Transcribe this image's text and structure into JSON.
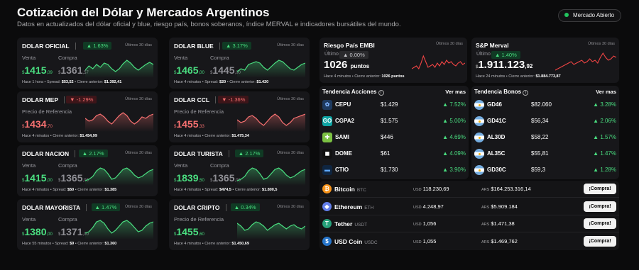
{
  "header": {
    "title": "Cotización del Dólar y Mercados Argentinos",
    "subtitle": "Datos en actualizados del dólar oficial y blue, riesgo país, bonos soberanos, índice MERVAL e indicadores bursátiles del mundo.",
    "status": "Mercado Abierto"
  },
  "colors": {
    "up": "#4ade80",
    "down": "#f87171",
    "muted": "#8f8f95",
    "panel": "#17171a",
    "background": "#0b0b0c"
  },
  "dollars": [
    {
      "name": "DOLAR OFICIAL",
      "change": "▲ 1.63%",
      "dir": "up",
      "period": "Últimos 30 días",
      "label1": "Venta",
      "label2": "Compra",
      "sell_main": "1415",
      "sell_dec": ",09",
      "buy_main": "1361",
      "buy_dec": ",57",
      "currency": "$",
      "footer": {
        "time": "Hace 1 hora",
        "metric_label": "Spread",
        "metric_value": "$53,52",
        "close_label": "Cierre anterior",
        "close_value": "$1.392,41"
      }
    },
    {
      "name": "DOLAR BLUE",
      "change": "▲ 3.17%",
      "dir": "up",
      "period": "Últimos 30 días",
      "label1": "Venta",
      "label2": "Compra",
      "sell_main": "1465",
      "sell_dec": ",00",
      "buy_main": "1445",
      "buy_dec": ",00",
      "currency": "$",
      "footer": {
        "time": "Hace 4 minutos",
        "metric_label": "Spread",
        "metric_value": "$20",
        "close_label": "Cierre anterior",
        "close_value": "$1.420"
      }
    },
    {
      "name": "DOLAR MEP",
      "change": "▼ -1.29%",
      "dir": "down",
      "period": "Últimos 30 días",
      "label1": "Precio de Referencia",
      "label2": "",
      "sell_main": "1434",
      "sell_dec": ",70",
      "buy_main": "",
      "buy_dec": "",
      "currency": "$",
      "footer": {
        "time": "Hace 4 minutos",
        "metric_label": "",
        "metric_value": "",
        "close_label": "Cierre anterior",
        "close_value": "$1.454,99"
      }
    },
    {
      "name": "DOLAR CCL",
      "change": "▼ -1.36%",
      "dir": "down",
      "period": "Últimos 30 días",
      "label1": "Precio de Referencia",
      "label2": "",
      "sell_main": "1455",
      "sell_dec": ",33",
      "buy_main": "",
      "buy_dec": "",
      "currency": "$",
      "footer": {
        "time": "Hace 4 minutos",
        "metric_label": "",
        "metric_value": "",
        "close_label": "Cierre anterior",
        "close_value": "$1.475,34"
      }
    },
    {
      "name": "DOLAR NACION",
      "change": "▲ 2.17%",
      "dir": "up",
      "period": "Últimos 30 días",
      "label1": "Venta",
      "label2": "Compra",
      "sell_main": "1415",
      "sell_dec": ",00",
      "buy_main": "1365",
      "buy_dec": ",00",
      "currency": "$",
      "footer": {
        "time": "Hace 4 minutos",
        "metric_label": "Spread",
        "metric_value": "$50",
        "close_label": "Cierre anterior",
        "close_value": "$1.385"
      }
    },
    {
      "name": "DOLAR TURISTA",
      "change": "▲ 2.17%",
      "dir": "up",
      "period": "Últimos 30 días",
      "label1": "Venta",
      "label2": "Compra",
      "sell_main": "1839",
      "sell_dec": ",50",
      "buy_main": "1365",
      "buy_dec": ",00",
      "currency": "$",
      "footer": {
        "time": "Hace 4 minutos",
        "metric_label": "Spread",
        "metric_value": "$474,5",
        "close_label": "Cierre anterior",
        "close_value": "$1.800,5"
      }
    },
    {
      "name": "DOLAR MAYORISTA",
      "change": "▲ 1.47%",
      "dir": "up",
      "period": "Últimos 30 días",
      "label1": "Venta",
      "label2": "Compra",
      "sell_main": "1380",
      "sell_dec": ",00",
      "buy_main": "1371",
      "buy_dec": ",00",
      "currency": "$",
      "footer": {
        "time": "Hace 55 minutos",
        "metric_label": "Spread",
        "metric_value": "$9",
        "close_label": "Cierre anterior",
        "close_value": "$1.360"
      }
    },
    {
      "name": "DOLAR CRIPTO",
      "change": "▲ 0.34%",
      "dir": "up",
      "period": "Últimos 30 días",
      "label1": "Precio de Referencia",
      "label2": "",
      "sell_main": "1455",
      "sell_dec": ",60",
      "buy_main": "",
      "buy_dec": "",
      "currency": "$",
      "footer": {
        "time": "Hace 4 minutos",
        "metric_label": "",
        "metric_value": "",
        "close_label": "Cierre anterior",
        "close_value": "$1.450,69"
      }
    }
  ],
  "riesgo": {
    "title": "Riesgo País EMBI",
    "period": "Últimos 30 días",
    "label": "Último",
    "change": "▲ 0.00%",
    "value": "1026",
    "unit": "puntos",
    "footer_time": "Hace 4 minutos",
    "close_label": "Cierre anterior",
    "close_value": "1026 puntos"
  },
  "merval": {
    "title": "S&P Merval",
    "period": "Últimos 30 días",
    "label": "Último",
    "change": "▲ 1.40%",
    "value": "1.911.123",
    "value_dec": ",92",
    "currency": "$",
    "footer_time": "Hace 24 minutos",
    "close_label": "Cierre anterior",
    "close_value": "$1.884.773,87"
  },
  "acciones": {
    "title": "Tendencia Acciones",
    "more": "Ver mas",
    "rows": [
      {
        "name": "CEPU",
        "price": "$1.429",
        "change": "▲ 7.52%",
        "icon": "cepu-logo-icon",
        "glyph": "✿",
        "bg": "#1e3a5f",
        "fg": "#7fb3ff"
      },
      {
        "name": "CGPA2",
        "price": "$1.575",
        "change": "▲ 5.00%",
        "icon": "cgpa2-logo-icon",
        "glyph": "GO",
        "bg": "#0ea5a4",
        "fg": "#ffffff"
      },
      {
        "name": "SAMI",
        "price": "$446",
        "change": "▲ 4.69%",
        "icon": "sami-logo-icon",
        "glyph": "✚",
        "bg": "#7cc243",
        "fg": "#ffffff"
      },
      {
        "name": "DOME",
        "price": "$61",
        "change": "▲ 4.09%",
        "icon": "dome-logo-icon",
        "glyph": "◼",
        "bg": "#111111",
        "fg": "#ffffff"
      },
      {
        "name": "CTIO",
        "price": "$1.730",
        "change": "▲ 3.90%",
        "icon": "ctio-logo-icon",
        "glyph": "▬",
        "bg": "#0f2540",
        "fg": "#5fa8ff"
      }
    ]
  },
  "bonos": {
    "title": "Tendencia Bonos",
    "more": "Ver mas",
    "rows": [
      {
        "name": "GD46",
        "price": "$82.060",
        "change": "▲ 3.28%",
        "icon": "argentina-flag-icon"
      },
      {
        "name": "GD41C",
        "price": "$56,34",
        "change": "▲ 2.06%",
        "icon": "argentina-flag-icon"
      },
      {
        "name": "AL30D",
        "price": "$58,22",
        "change": "▲ 1.57%",
        "icon": "argentina-flag-icon"
      },
      {
        "name": "AL35C",
        "price": "$55,81",
        "change": "▲ 1.47%",
        "icon": "argentina-flag-icon"
      },
      {
        "name": "GD30C",
        "price": "$59,3",
        "change": "▲ 1.28%",
        "icon": "argentina-flag-icon"
      }
    ]
  },
  "crypto": [
    {
      "name": "Bitcoin",
      "sym": "BTC",
      "usd_cur": "USD",
      "usd": "118.230,69",
      "ars_cur": "ARS",
      "ars": "$164.253.316,14",
      "button": "¡Compra!",
      "icon": "bitcoin-icon",
      "glyph": "₿",
      "color": "#f7931a"
    },
    {
      "name": "Ethereum",
      "sym": "ETH",
      "usd_cur": "USD",
      "usd": "4.248,97",
      "ars_cur": "ARS",
      "ars": "$5.909.184",
      "button": "¡Compra!",
      "icon": "ethereum-icon",
      "glyph": "◆",
      "color": "#627eea"
    },
    {
      "name": "Tether",
      "sym": "USDT",
      "usd_cur": "USD",
      "usd": "1,056",
      "ars_cur": "ARS",
      "ars": "$1.471,38",
      "button": "¡Compra!",
      "icon": "tether-icon",
      "glyph": "T",
      "color": "#26a17b"
    },
    {
      "name": "USD Coin",
      "sym": "USDC",
      "usd_cur": "USD",
      "usd": "1,055",
      "ars_cur": "ARS",
      "ars": "$1.469,762",
      "button": "¡Compra!",
      "icon": "usd-coin-icon",
      "glyph": "$",
      "color": "#2775ca"
    }
  ]
}
